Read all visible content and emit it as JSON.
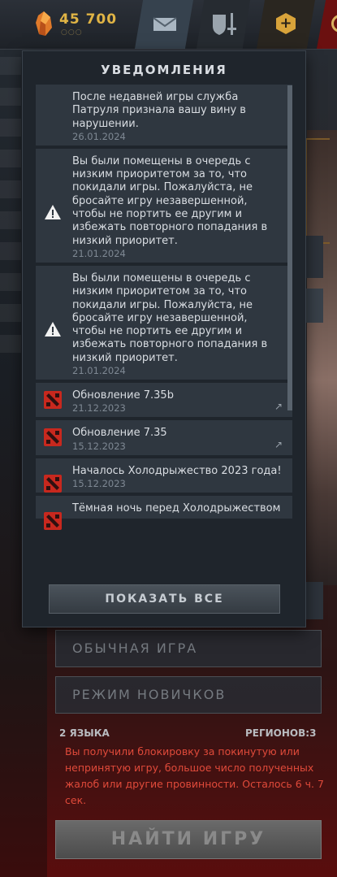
{
  "topbar": {
    "shards": "45 700",
    "dots": "○○○",
    "icons": [
      "shard-icon",
      "mail-icon",
      "guild-icon",
      "plus-icon",
      "profile-ring-icon"
    ],
    "colors": {
      "gold": "#e0b445",
      "mail_active": "#36424e"
    }
  },
  "notifications": {
    "title": "УВЕДОМЛЕНИЯ",
    "items": [
      {
        "icon": "none",
        "text": "После недавней игры служба Патруля признала вашу вину в нарушении.",
        "date": "26.01.2024"
      },
      {
        "icon": "warning-icon",
        "text": "Вы были помещены в очередь с низким приоритетом за то, что покидали игры. Пожалуйста, не бросайте игру незавершенной, чтобы не портить ее другим и избежать повторного попадания в низкий приоритет.",
        "date": "21.01.2024"
      },
      {
        "icon": "warning-icon",
        "text": "Вы были помещены в очередь с низким приоритетом за то, что покидали игры. Пожалуйста, не бросайте игру незавершенной, чтобы не портить ее другим и избежать повторного попадания в низкий приоритет.",
        "date": "21.01.2024"
      },
      {
        "icon": "dota-icon",
        "text": "Обновление 7.35b",
        "date": "21.12.2023",
        "arrow": "↗"
      },
      {
        "icon": "dota-icon",
        "text": "Обновление 7.35",
        "date": "15.12.2023",
        "arrow": "↗"
      },
      {
        "icon": "dota-icon",
        "text": "Началось Холодрыжество 2023 года!",
        "date": "15.12.2023"
      },
      {
        "icon": "dota-icon",
        "text": "Тёмная ночь перед Холодрыжеством",
        "date": ""
      }
    ],
    "show_all": "ПОКАЗАТЬ ВСЕ"
  },
  "modes": {
    "normal": "ОБЫЧНАЯ ИГРА",
    "novice": "РЕЖИМ НОВИЧКОВ"
  },
  "info": {
    "languages": "2 ЯЗЫКА",
    "regions": "РЕГИОНОВ:3"
  },
  "warning": "Вы получили блокировку за покинутую или непринятую игру, большое число полученных жалоб или другие провинности. Осталось 6 ч. 7 сек.",
  "find_game": "НАЙТИ ИГРУ",
  "colors": {
    "warning_red": "#e04a3a",
    "panel_bg": "#1f252c",
    "item_bg": "#2f3740"
  }
}
